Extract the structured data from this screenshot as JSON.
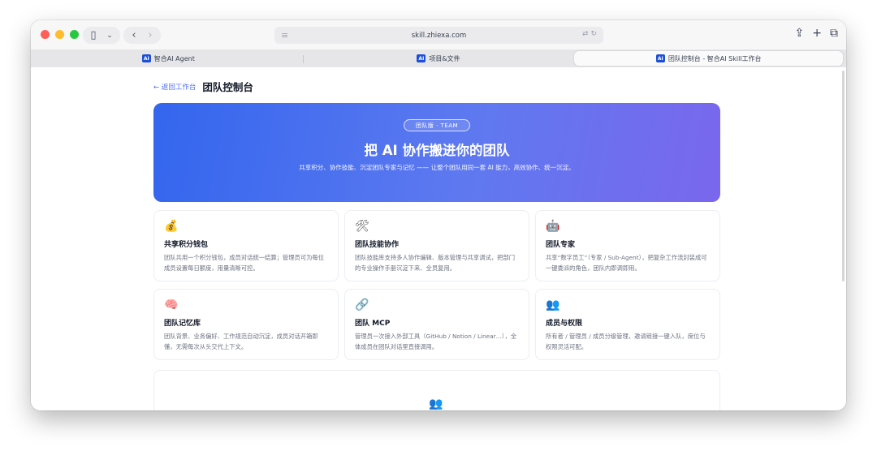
{
  "browser": {
    "url": "skill.zhiexa.com",
    "tabs": [
      {
        "logo": "AI",
        "label": "智合AI Agent",
        "active": false
      },
      {
        "logo": "AI",
        "label": "项目&文件",
        "active": false
      },
      {
        "logo": "AI",
        "label": "团队控制台 - 智合AI Skill工作台",
        "active": true
      }
    ]
  },
  "page": {
    "back_label": "← 返回工作台",
    "title": "团队控制台"
  },
  "hero": {
    "badge": "团队版 · TEAM",
    "title": "把 AI 协作搬进你的团队",
    "subtitle": "共享积分、协作技能、沉淀团队专家与记忆 —— 让整个团队用同一套 AI 能力，高效协作、统一沉淀。"
  },
  "cards": [
    {
      "icon": "money-bag-icon",
      "emoji": "💰",
      "title": "共享积分钱包",
      "desc": "团队共用一个积分钱包，成员对话统一结算；管理员可为每位成员设置每日额度，用量清晰可控。"
    },
    {
      "icon": "tools-icon",
      "emoji": "🛠",
      "title": "团队技能协作",
      "desc": "团队技能库支持多人协作编辑、版本管理与共享调试，把部门的专业操作手册沉淀下来、全员复用。"
    },
    {
      "icon": "robot-icon",
      "emoji": "🤖",
      "title": "团队专家",
      "desc": "共享“数字员工”（专家 / Sub-Agent），把复杂工作流封装成可一键委派的角色，团队内即调即用。"
    },
    {
      "icon": "brain-icon",
      "emoji": "🧠",
      "title": "团队记忆库",
      "desc": "团队背景、业务偏好、工作规范自动沉淀，成员对话开箱即懂，无需每次从头交代上下文。"
    },
    {
      "icon": "link-icon",
      "emoji": "🔗",
      "title": "团队 MCP",
      "desc": "管理员一次接入外部工具（GitHub / Notion / Linear…），全体成员在团队对话里直接调用。"
    },
    {
      "icon": "people-icon",
      "emoji": "👥",
      "title": "成员与权限",
      "desc": "所有者 / 管理员 / 成员分级管理，邀请链接一键入队，席位与权限灵活可配。"
    }
  ],
  "bottom": {
    "icon": "people-icon",
    "emoji": "👥"
  }
}
